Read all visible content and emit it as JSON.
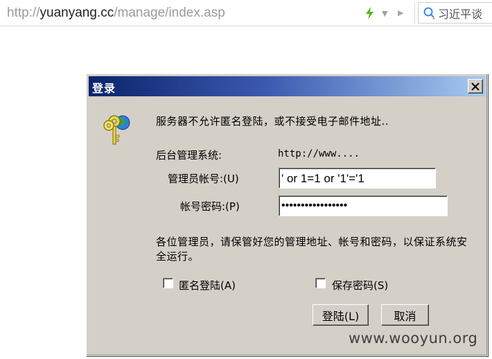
{
  "browser": {
    "url_protocol": "http://",
    "url_host": "yuanyang.cc",
    "url_path": "/manage/index.asp",
    "search_text": "习近平谈"
  },
  "dialog": {
    "title": "登录",
    "message": "服务器不允许匿名登陆，或不接受电子邮件地址..",
    "system_label": "后台管理系统:",
    "system_value": "http://www....",
    "username_label": "管理员帐号:(U)",
    "username_value": "' or 1=1 or '1'='1",
    "password_label": "帐号密码:(P)",
    "password_value": "•••••••••••••••••",
    "notice": "各位管理员，请保管好您的管理地址、帐号和密码，以保证系统安全运行。",
    "anonymous_login_label": "匿名登陆(A)",
    "anonymous_login_checked": false,
    "save_password_label": "保存密码(S)",
    "save_password_checked": false,
    "login_button": "登陆(L)",
    "cancel_button": "取消"
  },
  "watermark": "www.wooyun.org",
  "icons": [
    "lightning-icon",
    "dropdown-arrow-icon",
    "go-arrow-icon",
    "search-icon",
    "close-icon",
    "keys-icon"
  ]
}
